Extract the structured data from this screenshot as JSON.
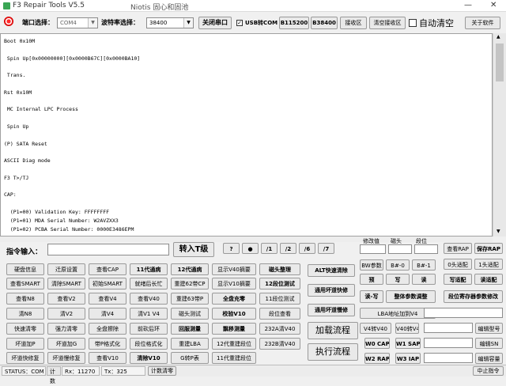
{
  "window": {
    "title": "F3 Repair Tools V5.5",
    "author": "Niotis   固心和固池",
    "minimize": "—",
    "close": "✕"
  },
  "toolbar": {
    "port_label": "端口选择：",
    "port_value": "COM4",
    "baud_label": "波特率选择：",
    "baud_value": "38400",
    "close_port": "关闭串口",
    "usb_com": "USB转COM",
    "b115200": "B115200",
    "b38400": "B38400",
    "receive_area": "接收区",
    "clear_receive": "清空接收区",
    "auto_clear": "自动清空",
    "about": "关于软件"
  },
  "console": {
    "lines": [
      "Boot 0x10M",
      "",
      " Spin Up[0x00000000][0x0000B67C][0x0000BA10]",
      "",
      " Trans.",
      "",
      "Rst 0x10M",
      "",
      " MC Internal LPC Process",
      "",
      " Spin Up",
      "",
      "(P) SATA Reset",
      "",
      "ASCII Diag mode",
      "",
      "F3 T>/TJ",
      "",
      "CAP:",
      "",
      "  (P1=00) Validation Key: FFFFFFFF",
      "  (P1=01) MDA Serial Number: W2AVZXX3",
      "  (P1=02) PCBA Serial Number: 0000E3486EPM"
    ]
  },
  "params_header": {
    "modify_value": "修改值",
    "head": "磁头",
    "segment": "段位"
  },
  "command_input": {
    "label": "指令输入：",
    "button": "转入T级"
  },
  "symbols": [
    "?",
    "●",
    "/1",
    "/2",
    "/6",
    "/7"
  ],
  "grid": [
    [
      "硬盘信息",
      "迁原设置",
      "查看CAP",
      "11代通病",
      "12代通病",
      "显示V40摘要",
      "磁头整理"
    ],
    [
      "查看SMART",
      "清除SMART",
      "初始SMART",
      "就绪后长忙",
      "重建62带CP",
      "显示V10摘要",
      "12段位测试"
    ],
    [
      "查看N8",
      "查看V2",
      "查看V4",
      "查看V40",
      "重建63带P",
      "全盘充零",
      "11段位测试"
    ],
    [
      "清N8",
      "清V2",
      "清V4",
      "清V1 V4",
      "磁头测试",
      "校验V10",
      "段位查看"
    ],
    [
      "快速清零",
      "强力清零",
      "全盘擦除",
      "前砍后环",
      "回服测量",
      "飘移测量",
      "232A清V40"
    ],
    [
      "坏道加P",
      "坏道加G",
      "带P格式化",
      "段位格式化",
      "重建LBA",
      "12代重建段位",
      "232B清V40"
    ],
    [
      "坏道快修复",
      "坏道慢修复",
      "查看V10",
      "清除V10",
      "G转P表",
      "11代重建段位"
    ]
  ],
  "middle": {
    "alt_clear": "ALT快速清除",
    "generic_fast": "通用坏道快修",
    "generic_slow": "通用坏道慢修",
    "load_flow": "加载流程",
    "exec_flow": "执行流程"
  },
  "right": {
    "bw_params": "BW参数",
    "bw0": "B#-0",
    "bw1": "B#-1",
    "predict": "预",
    "write": "写",
    "read": "读",
    "rw": "读-写",
    "all_params": "整体参数调整",
    "lba_to_v4": "LBA地址加到V4",
    "v4_to_v40": "V4转V40",
    "v40_to_v4": "V40转V4",
    "w0_cap": "W0 CAP",
    "w1_sap": "W1 SAP",
    "w2_rap": "W2 RAP",
    "w3_iap": "W3 IAP",
    "view_rap": "查看RAP",
    "save_rap": "保存RAP",
    "zero_head": "0头适配",
    "one_head": "1头适配",
    "write_fit": "写适配",
    "read_fit": "读适配",
    "seg_reg": "段位寄存器参数修改",
    "edit_model": "编辑型号",
    "edit_sn": "编辑SN",
    "edit_cap": "编辑容量",
    "stop_cmd": "中止指令"
  },
  "statusbar": {
    "status": "STATUS：COM",
    "count": "计数",
    "rx": "Rx：11270",
    "tx": "Tx：325",
    "clear_count": "计数清零"
  }
}
